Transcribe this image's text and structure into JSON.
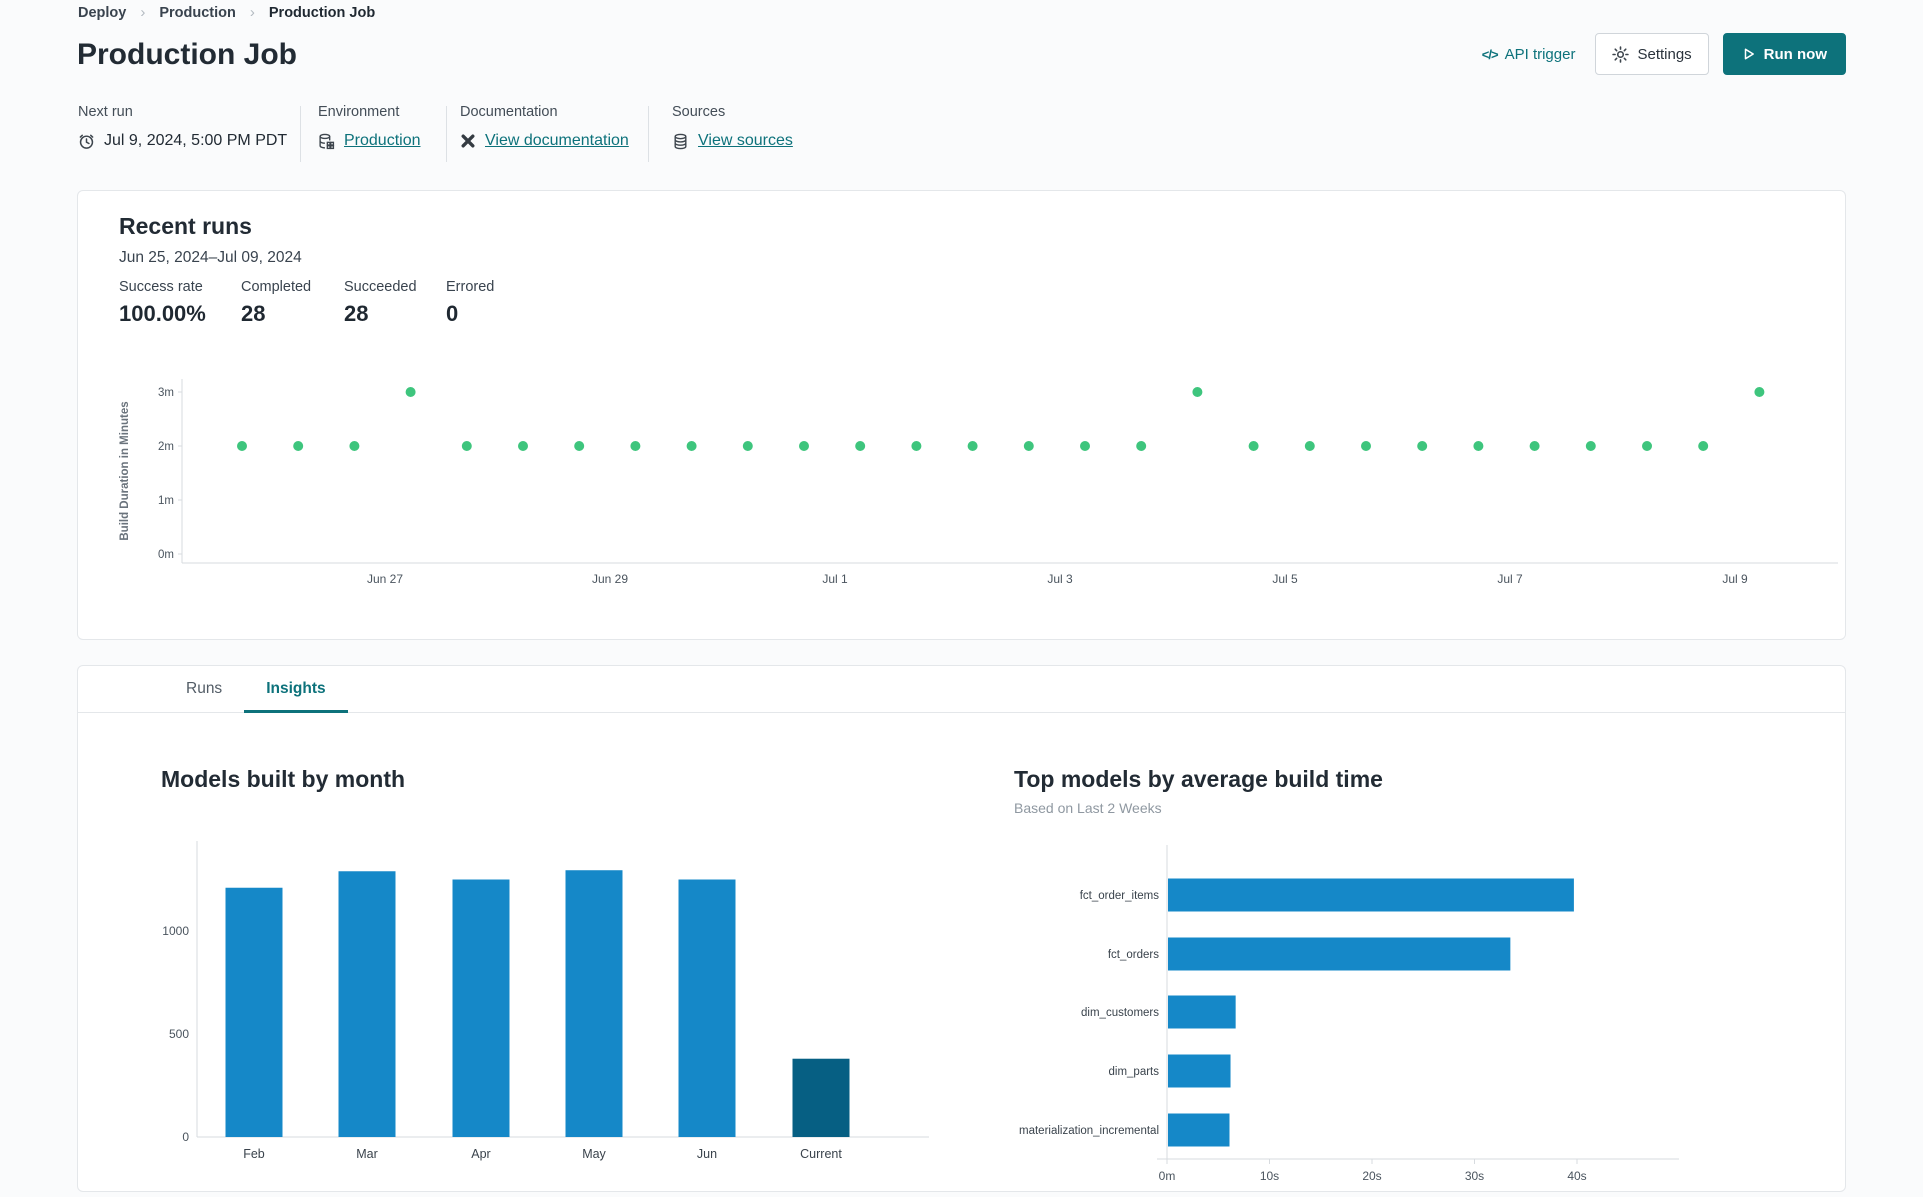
{
  "breadcrumb": {
    "items": [
      "Deploy",
      "Production",
      "Production Job"
    ],
    "separator": "›"
  },
  "header": {
    "title": "Production Job",
    "api_trigger_label": "API trigger",
    "api_trigger_glyph": "</>",
    "settings_label": "Settings",
    "run_now_label": "Run now"
  },
  "meta": {
    "columns": [
      {
        "label": "Next run",
        "value": "Jul 9, 2024, 5:00 PM PDT",
        "icon": "clock-icon",
        "is_link": false
      },
      {
        "label": "Environment",
        "value": "Production",
        "icon": "environment-database-icon",
        "is_link": true
      },
      {
        "label": "Documentation",
        "value": "View documentation",
        "icon": "dbt-docs-icon",
        "is_link": true
      },
      {
        "label": "Sources",
        "value": "View sources",
        "icon": "database-icon",
        "is_link": true
      }
    ]
  },
  "recent_runs": {
    "title": "Recent runs",
    "date_range": "Jun 25, 2024–Jul 09, 2024",
    "stats": [
      {
        "label": "Success rate",
        "value": "100.00%"
      },
      {
        "label": "Completed",
        "value": "28"
      },
      {
        "label": "Succeeded",
        "value": "28"
      },
      {
        "label": "Errored",
        "value": "0"
      }
    ]
  },
  "tabs": [
    {
      "label": "Runs",
      "active": false
    },
    {
      "label": "Insights",
      "active": true
    }
  ],
  "colors": {
    "accent_teal": "#0d727b",
    "success_green": "#3ec57d",
    "bar_blue": "#1588c8",
    "bar_navy": "#065f83",
    "axis_line": "#d7dbdf",
    "tick_text": "#4a545e"
  },
  "chart_data": [
    {
      "name": "build-duration-scatter",
      "type": "scatter",
      "ylabel": "Build Duration in Minutes",
      "y_ticks": [
        "0m",
        "1m",
        "2m",
        "3m"
      ],
      "x_ticks": [
        "Jun 27",
        "Jun 29",
        "Jul 1",
        "Jul 3",
        "Jul 5",
        "Jul 7",
        "Jul 9"
      ],
      "ylim": [
        0,
        3.4
      ],
      "points_minutes": [
        2,
        2,
        2,
        3,
        2,
        2,
        2,
        2,
        2,
        2,
        2,
        2,
        2,
        2,
        2,
        2,
        2,
        3,
        2,
        2,
        2,
        2,
        2,
        2,
        2,
        2,
        2,
        3
      ],
      "point_color": "#3ec57d"
    },
    {
      "name": "models-built-by-month",
      "type": "bar",
      "title": "Models built by month",
      "categories": [
        "Feb",
        "Mar",
        "Apr",
        "May",
        "Jun",
        "Current"
      ],
      "values": [
        1210,
        1290,
        1250,
        1295,
        1250,
        380
      ],
      "bar_colors": [
        "#1588c8",
        "#1588c8",
        "#1588c8",
        "#1588c8",
        "#1588c8",
        "#065f83"
      ],
      "y_ticks": [
        0,
        500,
        1000
      ],
      "ylim": [
        0,
        1430
      ],
      "xlabel": "",
      "ylabel": ""
    },
    {
      "name": "top-models-by-average-build-time",
      "type": "hbar",
      "title": "Top models by average build time",
      "subtitle": "Based on Last 2 Weeks",
      "categories": [
        "fct_order_items",
        "fct_orders",
        "dim_customers",
        "dim_parts",
        "materialization_incremental"
      ],
      "values_seconds": [
        39.6,
        33.4,
        6.6,
        6.1,
        6.0
      ],
      "x_ticks": [
        "0m",
        "10s",
        "20s",
        "30s",
        "40s"
      ],
      "xlim": [
        0,
        43
      ],
      "bar_color": "#1588c8"
    }
  ]
}
